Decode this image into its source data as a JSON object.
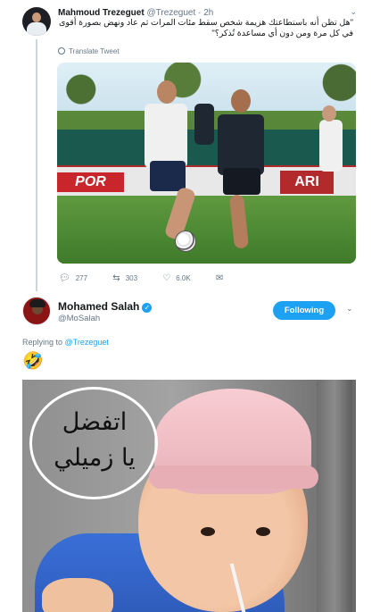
{
  "tweet1": {
    "author_name": "Mahmoud Trezeguet",
    "handle": "@Trezeguet",
    "separator": "·",
    "time": "2h",
    "text": "\"هل تظن أنه باستطاعتك هزيمة شخص سقط مئات المرات ثم عاد ونهض بصورة أقوى في كل مرة ومن دون أي مساعدة تُذكر؟\"",
    "translate_label": "Translate Tweet",
    "photo": {
      "banner_left": "POR",
      "banner_right": "ARI"
    },
    "actions": {
      "reply_count": "277",
      "retweet_count": "303",
      "like_count": "6.0K"
    }
  },
  "tweet2": {
    "author_name": "Mohamed Salah",
    "verified_glyph": "✓",
    "handle": "@MoSalah",
    "follow_label": "Following",
    "replying_prefix": "Replying to",
    "replying_to": "@Trezeguet",
    "emoji": "🤣",
    "meme_text_line1": "اتفضل",
    "meme_text_line2": "يا زميلي"
  },
  "icons": {
    "reply": "reply-icon",
    "retweet": "retweet-icon",
    "like": "heart-icon",
    "dm": "envelope-icon",
    "caret": "chevron-down-icon",
    "globe": "globe-icon"
  },
  "colors": {
    "accent": "#1da1f2",
    "muted": "#657786",
    "thread": "#ccd6dd"
  }
}
